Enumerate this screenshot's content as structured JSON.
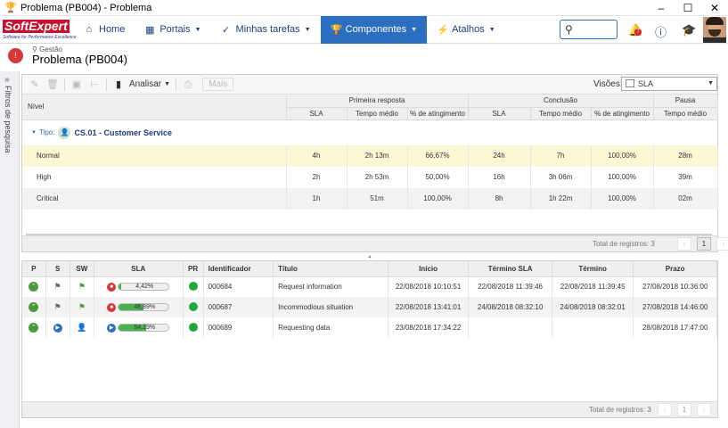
{
  "window": {
    "title": "Problema (PB004) - Problema"
  },
  "nav": {
    "logo_text": "SoftExpert",
    "logo_tagline": "Software for Performance Excellence",
    "items": [
      {
        "label": "Home",
        "icon": "home-icon"
      },
      {
        "label": "Portais",
        "icon": "dashboard-icon"
      },
      {
        "label": "Minhas tarefas",
        "icon": "checkmark-icon"
      },
      {
        "label": "Componentes",
        "icon": "trophy-icon"
      },
      {
        "label": "Atalhos",
        "icon": "lightning-icon"
      }
    ],
    "notification_count": "7"
  },
  "header": {
    "breadcrumb": "Gestão",
    "title": "Problema (PB004)"
  },
  "sidebar": {
    "label": "Filtros de pesquisa"
  },
  "toolbar": {
    "analisar_label": "Analisar",
    "mais_label": "Mais",
    "visoes_label": "Visões:",
    "visoes_value": "SLA"
  },
  "summary": {
    "group_headers": [
      "Nível",
      "Primeira resposta",
      "Conclusão",
      "Pausa"
    ],
    "sub_headers": [
      "SLA",
      "Tempo médio",
      "% de atingimento",
      "SLA",
      "Tempo médio",
      "% de atingimento",
      "Tempo médio"
    ],
    "tipo_prefix": "Tipo:",
    "tipo_name": "CS.01 - Customer Service",
    "rows": [
      [
        "Normal",
        "4h",
        "2h 13m",
        "66,67%",
        "24h",
        "7h",
        "100,00%",
        "28m"
      ],
      [
        "High",
        "2h",
        "2h 53m",
        "50,00%",
        "16h",
        "3h 06m",
        "100,00%",
        "39m"
      ],
      [
        "Critical",
        "1h",
        "51m",
        "100,00%",
        "8h",
        "1h 22m",
        "100,00%",
        "02m"
      ]
    ],
    "total_label": "Total de registros: 3",
    "page": "1"
  },
  "detail": {
    "headers": [
      "P",
      "S",
      "SW",
      "SLA",
      "PR",
      "Identificador",
      "Título",
      "Início",
      "Término SLA",
      "Término",
      "Prazo"
    ],
    "rows": [
      {
        "sla_pct": "4,42%",
        "sla_fraction": 0.0442,
        "id": "000684",
        "titulo": "Request information",
        "inicio": "22/08/2018 10:10:51",
        "termino_sla": "22/08/2018 11:39:46",
        "termino": "22/08/2018 11:39:45",
        "prazo": "27/08/2018 10:36:00"
      },
      {
        "sla_pct": "48,89%",
        "sla_fraction": 0.4889,
        "id": "000687",
        "titulo": "Incommodious situation",
        "inicio": "22/08/2018 13:41:01",
        "termino_sla": "24/08/2018 08:32:10",
        "termino": "24/08/2018 08:32:01",
        "prazo": "27/08/2018 14:46:00"
      },
      {
        "sla_pct": "54,19%",
        "sla_fraction": 0.5419,
        "id": "000689",
        "titulo": "Requesting data",
        "inicio": "23/08/2018 17:34:22",
        "termino_sla": "",
        "termino": "",
        "prazo": "28/08/2018 17:47:00"
      }
    ],
    "total_label": "Total de registros: 3",
    "page": "1"
  }
}
